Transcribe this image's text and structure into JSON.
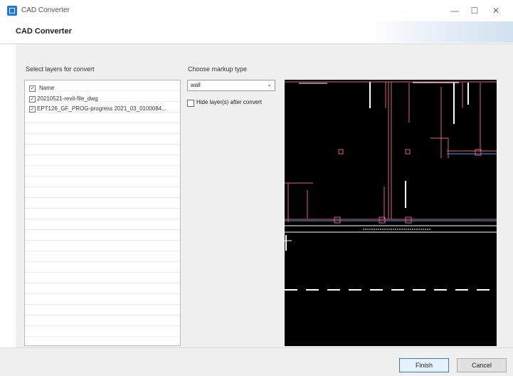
{
  "window": {
    "title": "CAD Converter",
    "minimize_glyph": "—",
    "maximize_glyph": "☐",
    "close_glyph": "✕"
  },
  "dialog": {
    "title": "CAD Converter"
  },
  "layers": {
    "label": "Select layers for convert",
    "header": {
      "label": "Name",
      "checked": true
    },
    "items": [
      {
        "label": "20210521-revit-file_dwg",
        "checked": true
      },
      {
        "label": "EPT126_GF_PROG-progress 2021_03_0100084...",
        "checked": true
      }
    ]
  },
  "markup": {
    "label": "Choose markup type",
    "selected": "wall",
    "hide_layers_label": "Hide layer(s) after convert",
    "hide_layers_checked": false
  },
  "buttons": {
    "finish": "Finish",
    "cancel": "Cancel"
  },
  "icons": {
    "app": "cad-converter-icon",
    "dropdown": "chevron-down-icon"
  },
  "colors": {
    "accent": "#1e78d4",
    "preview_background": "#000000",
    "preview_lines_pink": "#e0617f",
    "preview_lines_blue": "#3ea3d8",
    "preview_lines_white": "#ffffff"
  }
}
